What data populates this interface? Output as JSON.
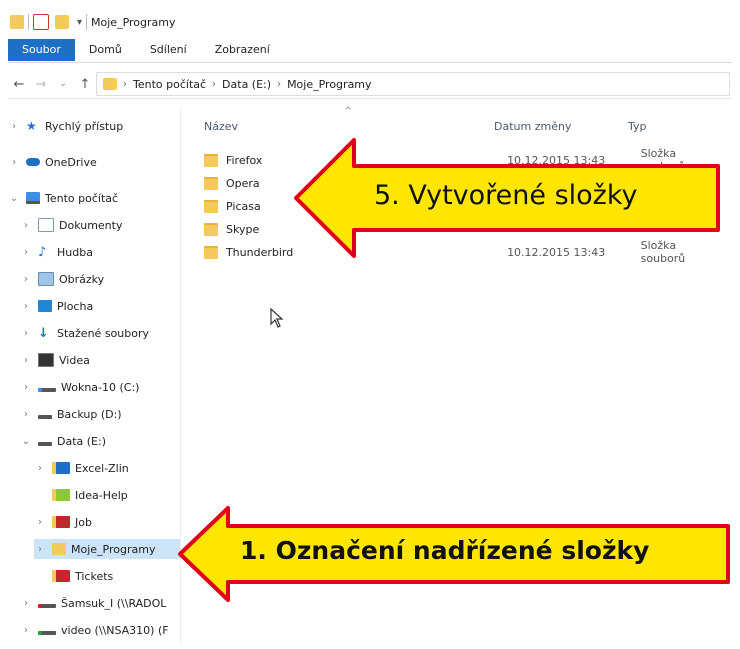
{
  "window": {
    "title": "Moje_Programy"
  },
  "menu": {
    "file": "Soubor",
    "home": "Domů",
    "share": "Sdílení",
    "view": "Zobrazení"
  },
  "address": {
    "crumbs": [
      "Tento počítač",
      "Data (E:)",
      "Moje_Programy"
    ]
  },
  "columns": {
    "name": "Název",
    "date": "Datum změny",
    "type": "Typ"
  },
  "files": [
    {
      "name": "Firefox",
      "date": "10.12.2015 13:43",
      "type": "Složka souborů"
    },
    {
      "name": "Opera",
      "date": "",
      "type": ""
    },
    {
      "name": "Picasa",
      "date": "",
      "type": ""
    },
    {
      "name": "Skype",
      "date": "",
      "type": ""
    },
    {
      "name": "Thunderbird",
      "date": "10.12.2015 13:43",
      "type": "Složka souborů"
    }
  ],
  "sidebar": [
    {
      "label": "Rychlý přístup",
      "icon": "star-icon"
    },
    {
      "label": "OneDrive",
      "icon": "cloud-icon"
    },
    {
      "label": "Tento počítač",
      "icon": "computer-icon"
    },
    {
      "label": "Dokumenty",
      "icon": "documents-icon"
    },
    {
      "label": "Hudba",
      "icon": "music-icon"
    },
    {
      "label": "Obrázky",
      "icon": "pictures-icon"
    },
    {
      "label": "Plocha",
      "icon": "desktop-icon"
    },
    {
      "label": "Stažené soubory",
      "icon": "download-icon"
    },
    {
      "label": "Videa",
      "icon": "video-icon"
    },
    {
      "label": "Wokna-10 (C:)",
      "icon": "drive-icon"
    },
    {
      "label": "Backup (D:)",
      "icon": "drive-icon"
    },
    {
      "label": "Data (E:)",
      "icon": "drive-icon"
    },
    {
      "label": "Excel-Zlin",
      "icon": "folder-icon"
    },
    {
      "label": "Idea-Help",
      "icon": "folder-icon"
    },
    {
      "label": "Job",
      "icon": "folder-icon"
    },
    {
      "label": "Moje_Programy",
      "icon": "folder-icon"
    },
    {
      "label": "Tickets",
      "icon": "folder-icon"
    },
    {
      "label": "Šamsuk_I (\\\\RADOL",
      "icon": "network-drive-icon"
    },
    {
      "label": "video (\\\\NSA310) (F",
      "icon": "network-drive-icon"
    }
  ],
  "callouts": {
    "top": "5. Vytvořené složky",
    "bottom": "1. Označení nadřízené složky"
  },
  "colors": {
    "accent": "#1f6fc4",
    "callout_fill": "#ffe600",
    "callout_border": "#e0001b",
    "selection": "#cce4f7",
    "folder": "#f4c95d"
  }
}
